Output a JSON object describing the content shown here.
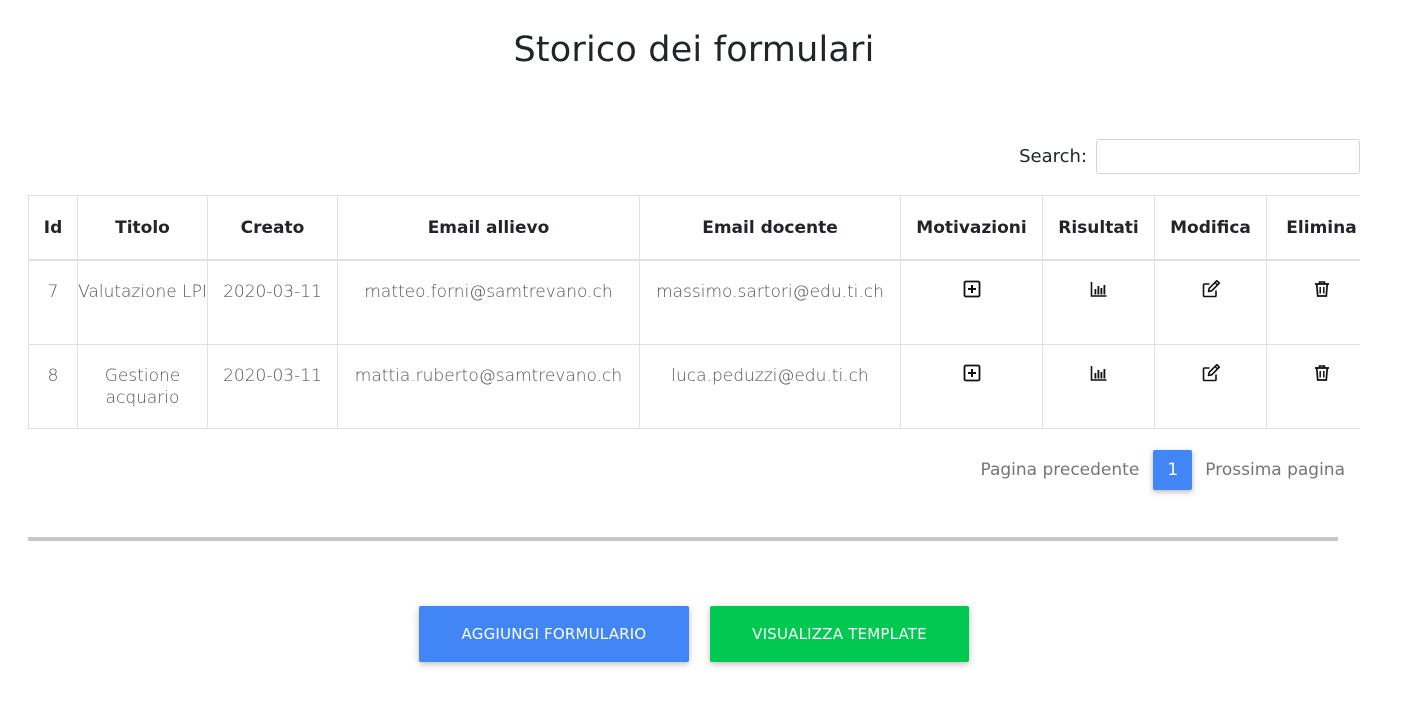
{
  "page": {
    "title": "Storico dei formulari"
  },
  "search": {
    "label": "Search:",
    "value": "",
    "placeholder": ""
  },
  "table": {
    "columns": [
      "Id",
      "Titolo",
      "Creato",
      "Email allievo",
      "Email docente",
      "Motivazioni",
      "Risultati",
      "Modifica",
      "Elimina"
    ],
    "rows": [
      {
        "id": "7",
        "titolo": "Valutazione LPI",
        "creato": "2020-03-11",
        "email_allievo": "matteo.forni@samtrevano.ch",
        "email_docente": "massimo.sartori@edu.ti.ch",
        "motivazioni_icon": "plus-square-icon",
        "risultati_icon": "bar-chart-icon",
        "modifica_icon": "edit-icon",
        "elimina_icon": "trash-icon"
      },
      {
        "id": "8",
        "titolo": "Gestione acquario",
        "creato": "2020-03-11",
        "email_allievo": "mattia.ruberto@samtrevano.ch",
        "email_docente": "luca.peduzzi@edu.ti.ch",
        "motivazioni_icon": "plus-square-icon",
        "risultati_icon": "bar-chart-icon",
        "modifica_icon": "edit-icon",
        "elimina_icon": "trash-icon"
      }
    ]
  },
  "pagination": {
    "previous_label": "Pagina precedente",
    "current_page": "1",
    "next_label": "Prossima pagina"
  },
  "actions": {
    "add_label": "Aggiungi formulario",
    "template_label": "Visualizza template"
  },
  "colors": {
    "primary": "#4285f4",
    "success": "#00c851",
    "divider": "#c7c7c7",
    "border": "#dee2e6"
  }
}
